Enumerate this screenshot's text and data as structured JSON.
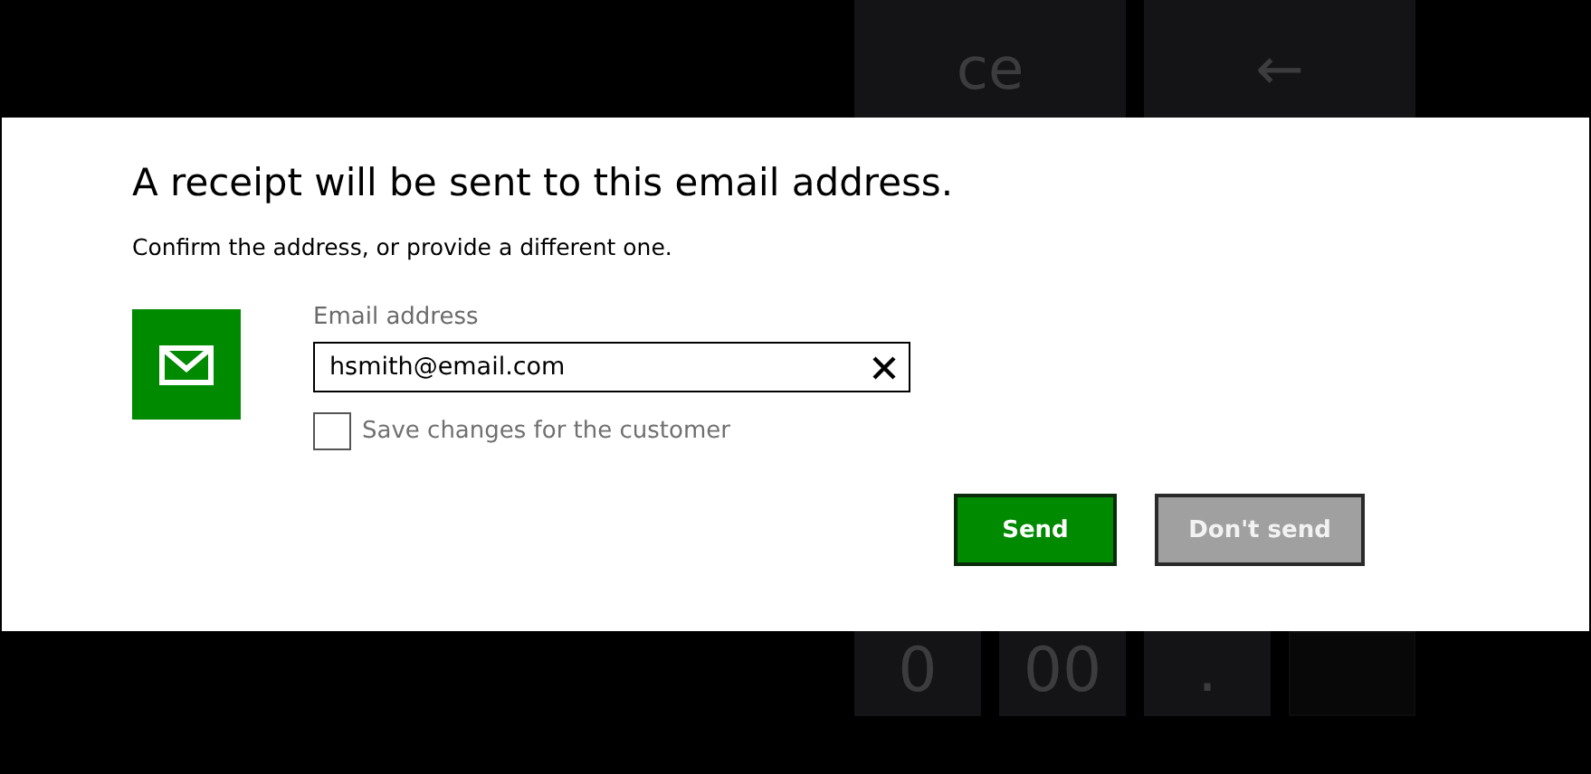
{
  "keypad_top": [
    {
      "label": "ce",
      "kind": "key"
    },
    {
      "label": "←",
      "kind": "key"
    }
  ],
  "dialog": {
    "title": "A receipt will be sent to this email address.",
    "message": "Confirm the address, or provide a different one.",
    "email": {
      "label": "Email address",
      "value": "hsmith@email.com"
    },
    "save_checkbox": {
      "label": "Save changes for the customer",
      "checked": false
    },
    "buttons": [
      {
        "label": "Send",
        "kind": "primary"
      },
      {
        "label": "Don't send",
        "kind": "secondary"
      }
    ]
  },
  "keypad_bottom": [
    {
      "label": "0",
      "kind": "key"
    },
    {
      "label": "00",
      "kind": "key"
    },
    {
      "label": ".",
      "kind": "key"
    },
    {
      "kind": "blank"
    }
  ]
}
